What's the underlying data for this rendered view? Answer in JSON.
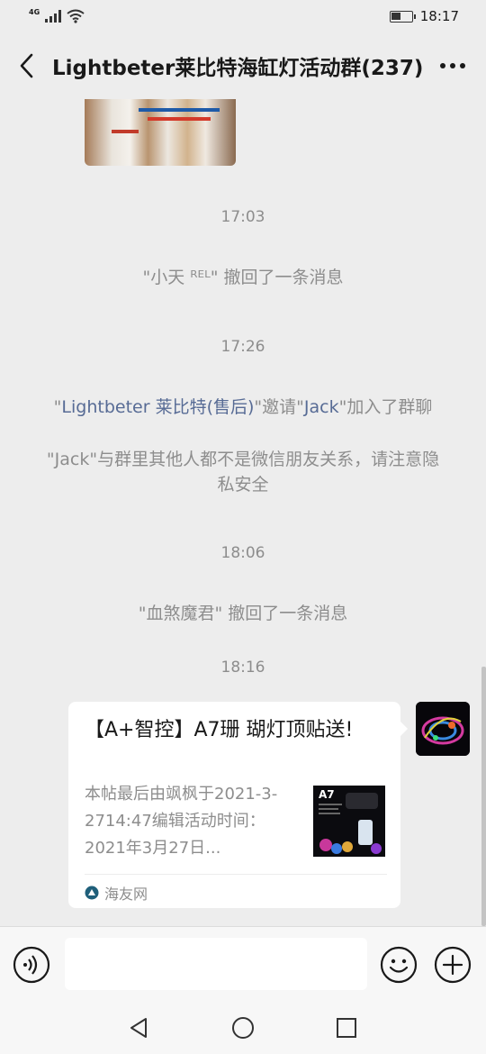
{
  "status_bar": {
    "network": "4G",
    "time": "18:17"
  },
  "header": {
    "title": "Lightbeter莱比特海缸灯活动群(237)"
  },
  "messages": {
    "ts_1": "17:03",
    "recall_1": "\"小天 ᴿᴱᴸ\" 撤回了一条消息",
    "ts_2": "17:26",
    "invite": {
      "q1": "\"",
      "inviter": "Lightbeter 莱比特(售后)",
      "mid": "\"邀请\"",
      "invitee": "Jack",
      "end": "\"加入了群聊"
    },
    "privacy_notice": "\"Jack\"与群里其他人都不是微信朋友关系，请注意隐私安全",
    "ts_3": "18:06",
    "recall_2": "\"血煞魔君\" 撤回了一条消息",
    "ts_4": "18:16"
  },
  "link_card": {
    "title": "【A+智控】A7珊 瑚灯顶贴送!",
    "description": "本帖最后由飒枫于2021-3-2714:47编辑活动时间：2021年3月27日...",
    "thumb_label": "A7",
    "source": "海友网"
  },
  "input": {
    "placeholder": ""
  },
  "icons": {
    "back": "chevron-left-icon",
    "more": "more-dots-icon",
    "voice": "voice-icon",
    "emoji": "emoji-icon",
    "plus": "plus-icon"
  },
  "colors": {
    "background": "#ededed",
    "link": "#576b95",
    "system_text": "#8d8d8d",
    "bubble": "#ffffff"
  }
}
